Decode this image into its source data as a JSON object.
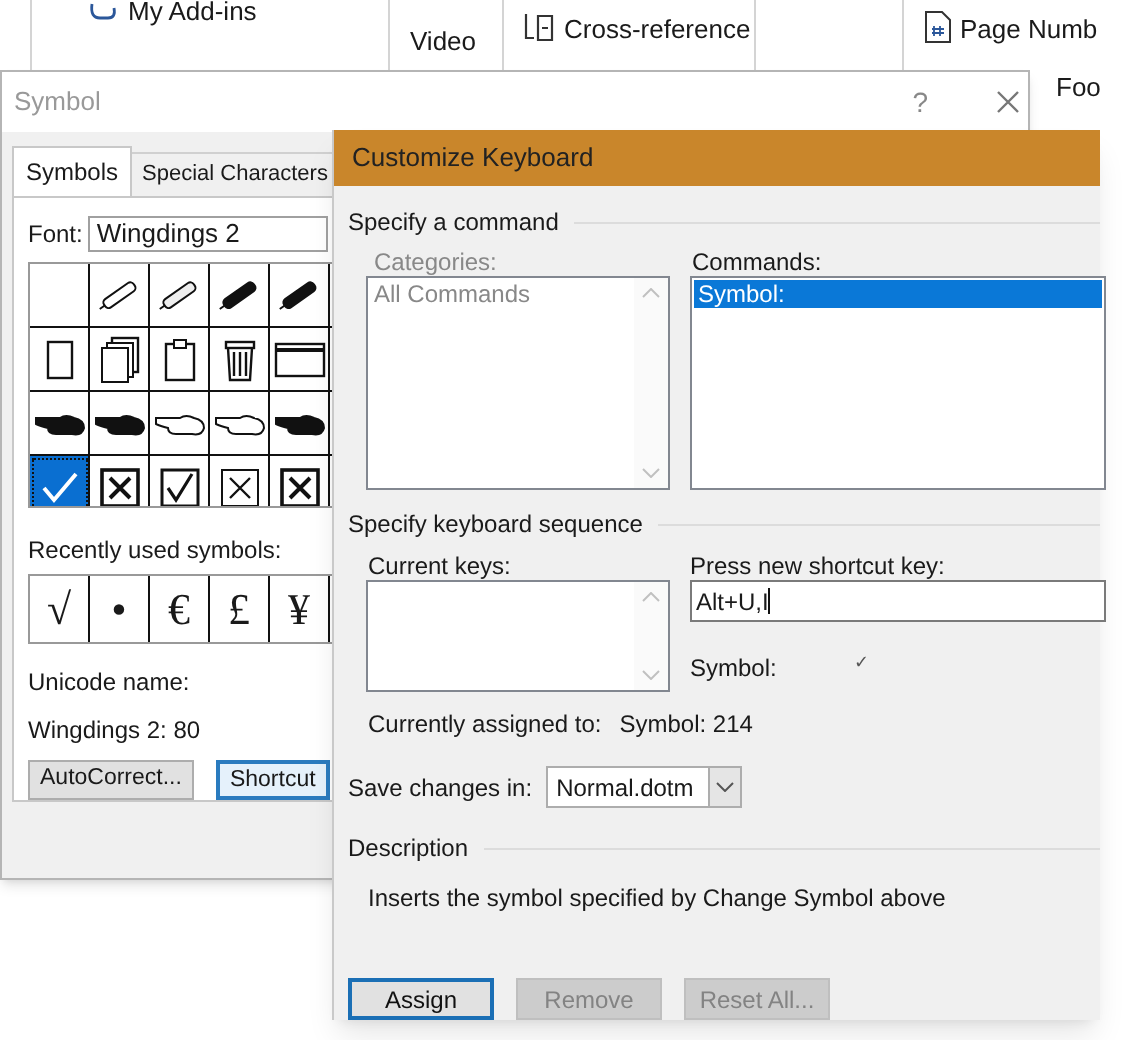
{
  "ribbon": {
    "items": [
      {
        "kind": "addins",
        "label": "My Add-ins"
      },
      {
        "kind": "video",
        "label": "Video"
      },
      {
        "kind": "crossref",
        "label": "Cross-reference"
      },
      {
        "kind": "empty"
      },
      {
        "kind": "pagenum",
        "label": "Page Numb"
      }
    ],
    "lower_label": "Foo"
  },
  "symbol_dialog": {
    "title": "Symbol",
    "help": "?",
    "tabs": [
      {
        "label": "Symbols",
        "selected": true
      },
      {
        "label": "Special Characters",
        "selected": false
      }
    ],
    "font_label": "Font:",
    "font_value": "Wingdings 2",
    "symbols": [
      {
        "kind": "blank",
        "selected": false
      },
      {
        "kind": "pencil",
        "selected": false
      },
      {
        "kind": "pen",
        "selected": false
      },
      {
        "kind": "brush",
        "selected": false
      },
      {
        "kind": "marker",
        "selected": false
      },
      {
        "kind": "page",
        "selected": false
      },
      {
        "kind": "pages",
        "selected": false
      },
      {
        "kind": "clipboard",
        "selected": false
      },
      {
        "kind": "bin",
        "selected": false
      },
      {
        "kind": "window",
        "selected": false
      },
      {
        "kind": "hand-black",
        "selected": false
      },
      {
        "kind": "hand-black",
        "selected": false
      },
      {
        "kind": "hand-white",
        "selected": false
      },
      {
        "kind": "hand-white",
        "selected": false
      },
      {
        "kind": "hand-black",
        "selected": false
      },
      {
        "kind": "check",
        "selected": true
      },
      {
        "kind": "box-x",
        "selected": false
      },
      {
        "kind": "box-check",
        "selected": false
      },
      {
        "kind": "box-x-thin",
        "selected": false
      },
      {
        "kind": "box-x",
        "selected": false
      }
    ],
    "recent_label": "Recently used symbols:",
    "recent": [
      "√",
      "•",
      "€",
      "£",
      "¥"
    ],
    "unicode_name_label": "Unicode name:",
    "code": "Wingdings 2: 80",
    "buttons": [
      {
        "label": "AutoCorrect...",
        "focused": false
      },
      {
        "label": "Shortcut",
        "focused": true
      }
    ]
  },
  "customize_keyboard": {
    "title": "Customize Keyboard",
    "command_section": "Specify a command",
    "categories_label": "Categories:",
    "categories": [
      {
        "label": "All Commands",
        "selected": false
      }
    ],
    "commands_label": "Commands:",
    "commands": [
      {
        "label": "Symbol:",
        "selected": true
      }
    ],
    "sequence_section": "Specify keyboard sequence",
    "current_keys_label": "Current keys:",
    "new_key_label": "Press new shortcut key:",
    "new_key_value": "Alt+U,I",
    "preview_label": "Symbol:",
    "preview_symbol": "✓",
    "assigned_label": "Currently assigned to:",
    "assigned_value": "Symbol: 214",
    "save_label": "Save changes in:",
    "save_value": "Normal.dotm",
    "description_section": "Description",
    "description": "Inserts the symbol specified by Change Symbol above",
    "buttons": [
      {
        "label": "Assign",
        "disabled": false,
        "focused": true
      },
      {
        "label": "Remove",
        "disabled": true,
        "focused": false
      },
      {
        "label": "Reset All...",
        "disabled": true,
        "focused": false
      }
    ]
  }
}
